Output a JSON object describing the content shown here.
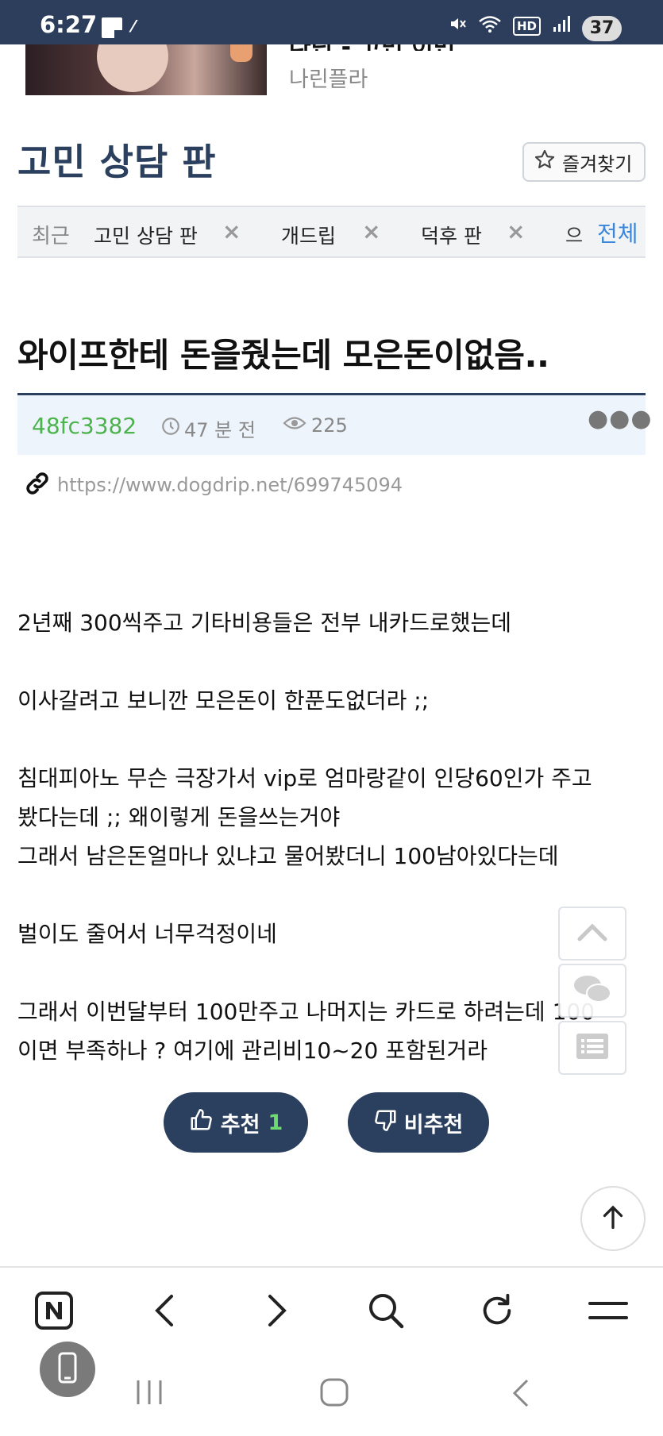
{
  "status_bar": {
    "time": "6:27",
    "battery": "37",
    "hd": "HD"
  },
  "banner": {
    "author": "나린플라",
    "title": "나린 - 고민 이번"
  },
  "board": {
    "title": "고민 상담 판",
    "favorite_label": "즐겨찾기"
  },
  "recent": {
    "label": "최근",
    "items": [
      "고민 상담 판",
      "개드립",
      "덕후 판"
    ],
    "more_fragment": "으",
    "all_label": "전체"
  },
  "post": {
    "title": "와이프한테 돈을줬는데 모은돈이없음..",
    "author": "48fc3382",
    "time": "47 분 전",
    "views": "225",
    "link": "https://www.dogdrip.net/699745094",
    "body": [
      "2년째 300씩주고 기타비용들은 전부 내카드로했는데",
      "",
      "이사갈려고 보니깐 모은돈이 한푼도없더라 ;;",
      "",
      "침대피아노 무슨 극장가서 vip로 엄마랑같이 인당60인가 주고",
      "봤다는데 ;; 왜이렇게 돈을쓰는거야",
      "그래서 남은돈얼마나 있냐고 물어봤더니 100남아있다는데",
      "",
      "벌이도 줄어서 너무걱정이네",
      "",
      "그래서 이번달부터 100만주고  나머지는 카드로 하려는데 100",
      "이면 부족하나 ? 여기에 관리비10~20 포함된거라"
    ],
    "upvote_label": "추천",
    "upvote_count": "1",
    "downvote_label": "비추천"
  },
  "colors": {
    "navy": "#2b3f5e",
    "author_green": "#4db34d",
    "link_blue": "#3a86d8",
    "meta_bg": "#edf4fc"
  },
  "icons": [
    "star-icon",
    "close-icon",
    "clock-icon",
    "eye-icon",
    "link-icon",
    "chevron-up-icon",
    "chat-icon",
    "list-icon",
    "thumbs-up-icon",
    "thumbs-down-icon",
    "arrow-up-icon",
    "naver-icon",
    "back-icon",
    "forward-icon",
    "search-icon",
    "refresh-icon",
    "menu-icon",
    "phone-icon"
  ]
}
